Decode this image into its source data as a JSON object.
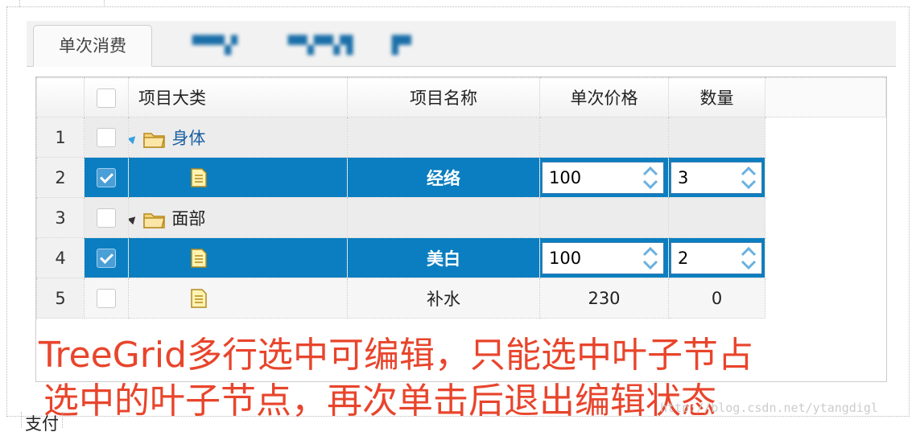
{
  "tabs": [
    {
      "label": "单次消费",
      "active": true
    },
    {
      "label": "▀▀▚▘",
      "active": false,
      "obscured": true
    },
    {
      "label": "▀▚▀▚▜",
      "active": false,
      "obscured": true
    },
    {
      "label": "▛▘",
      "active": false,
      "obscured": true
    }
  ],
  "grid": {
    "columns": [
      "项目大类",
      "项目名称",
      "单次价格",
      "数量"
    ],
    "rows": [
      {
        "num": "1",
        "checked": false,
        "type": "group",
        "expander": "expanded-blue",
        "icon": "folder-icon",
        "category": "身体",
        "name": "",
        "price": "",
        "qty": ""
      },
      {
        "num": "2",
        "checked": true,
        "type": "leaf-selected",
        "icon": "document-icon",
        "category": "",
        "name": "经络",
        "price": "100",
        "qty": "3"
      },
      {
        "num": "3",
        "checked": false,
        "type": "group",
        "expander": "expanded-dark",
        "icon": "folder-icon",
        "category": "面部",
        "name": "",
        "price": "",
        "qty": ""
      },
      {
        "num": "4",
        "checked": true,
        "type": "leaf-selected",
        "icon": "document-icon",
        "category": "",
        "name": "美白",
        "price": "100",
        "qty": "2"
      },
      {
        "num": "5",
        "checked": false,
        "type": "leaf",
        "icon": "document-icon",
        "category": "",
        "name": "补水",
        "price": "230",
        "qty": "0"
      }
    ]
  },
  "annotation": {
    "line1": "TreeGrid多行选中可编辑，只能选中叶子节占",
    "line2": "选中的叶子节点，再次单击后退出编辑状态"
  },
  "watermark": "http://blog.csdn.net/ytangdigl",
  "bottom_label": "支付",
  "colors": {
    "selected_row": "#0a7ec0",
    "annotation": "#e8452c",
    "group_row": "#ececec"
  }
}
